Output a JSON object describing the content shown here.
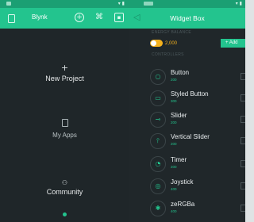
{
  "left": {
    "title": "Blynk",
    "items": [
      {
        "icon": "plus-icon",
        "label": "New Project"
      },
      {
        "icon": "apps-icon",
        "label": "My Apps"
      },
      {
        "icon": "community-icon",
        "label": "Community"
      }
    ]
  },
  "right": {
    "title": "Widget Box",
    "energy": {
      "label": "ENERGY BALANCE",
      "value": "2,000",
      "add_label": "+ Add"
    },
    "section_label": "CONTROLLERS",
    "widgets": [
      {
        "name": "Button",
        "price": "200",
        "icon": "button-icon"
      },
      {
        "name": "Styled Button",
        "price": "300",
        "icon": "styled-button-icon"
      },
      {
        "name": "Slider",
        "price": "200",
        "icon": "slider-icon"
      },
      {
        "name": "Vertical Slider",
        "price": "200",
        "icon": "vertical-slider-icon"
      },
      {
        "name": "Timer",
        "price": "200",
        "icon": "timer-icon"
      },
      {
        "name": "Joystick",
        "price": "400",
        "icon": "joystick-icon"
      },
      {
        "name": "zeRGBa",
        "price": "400",
        "icon": "zergba-icon"
      }
    ]
  },
  "colors": {
    "accent": "#23c48e",
    "energy": "#f4b11d",
    "background": "#1f2629"
  }
}
